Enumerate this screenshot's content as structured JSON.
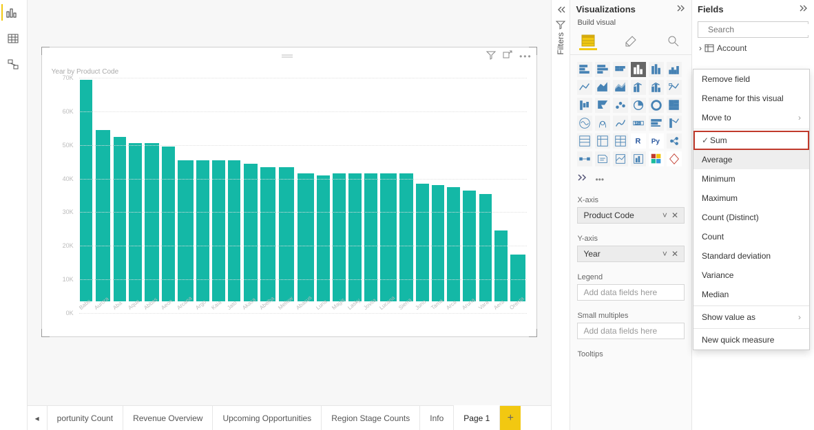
{
  "chart_data": {
    "type": "bar",
    "title": "Year by Product Code",
    "ylabel": "",
    "xlabel": "",
    "ylim": [
      0,
      70000
    ],
    "y_ticks": [
      "70K",
      "60K",
      "50K",
      "40K",
      "30K",
      "20K",
      "10K",
      "0K"
    ],
    "categories": [
      "Babo",
      "Aurora",
      "Aba",
      "Aqua",
      "Abbas",
      "Aeon",
      "Arcana",
      "Argo",
      "Kaia",
      "Jato",
      "Akasa",
      "Abelha",
      "Mellow",
      "Abacus",
      "Luna",
      "Magis",
      "Lasky",
      "Jovita",
      "Lucana",
      "Sierra",
      "Juno",
      "Tama",
      "Arca",
      "Aruna",
      "Vara",
      "Aera",
      "Orenta"
    ],
    "values": [
      66000,
      51000,
      49000,
      47000,
      47000,
      46000,
      42000,
      42000,
      42000,
      42000,
      41000,
      40000,
      40000,
      38000,
      37500,
      38000,
      38000,
      38000,
      38000,
      38000,
      35000,
      34500,
      34000,
      33000,
      32000,
      21000,
      14000
    ]
  },
  "panes": {
    "visualizations": "Visualizations",
    "build_visual": "Build visual",
    "fields": "Fields",
    "filters": "Filters"
  },
  "wells": {
    "x_axis_label": "X-axis",
    "x_axis_value": "Product Code",
    "y_axis_label": "Y-axis",
    "y_axis_value": "Year",
    "legend_label": "Legend",
    "legend_placeholder": "Add data fields here",
    "smallmult_label": "Small multiples",
    "smallmult_placeholder": "Add data fields here",
    "tooltips_label": "Tooltips"
  },
  "search": {
    "placeholder": "Search"
  },
  "tree": {
    "item0": "Account"
  },
  "tabs": {
    "items": [
      "portunity Count",
      "Revenue Overview",
      "Upcoming Opportunities",
      "Region Stage Counts",
      "Info",
      "Page 1"
    ]
  },
  "ctx": {
    "remove": "Remove field",
    "rename": "Rename for this visual",
    "moveto": "Move to",
    "sum": "Sum",
    "average": "Average",
    "minimum": "Minimum",
    "maximum": "Maximum",
    "countd": "Count (Distinct)",
    "count": "Count",
    "stddev": "Standard deviation",
    "variance": "Variance",
    "median": "Median",
    "showvalue": "Show value as",
    "newquick": "New quick measure"
  }
}
